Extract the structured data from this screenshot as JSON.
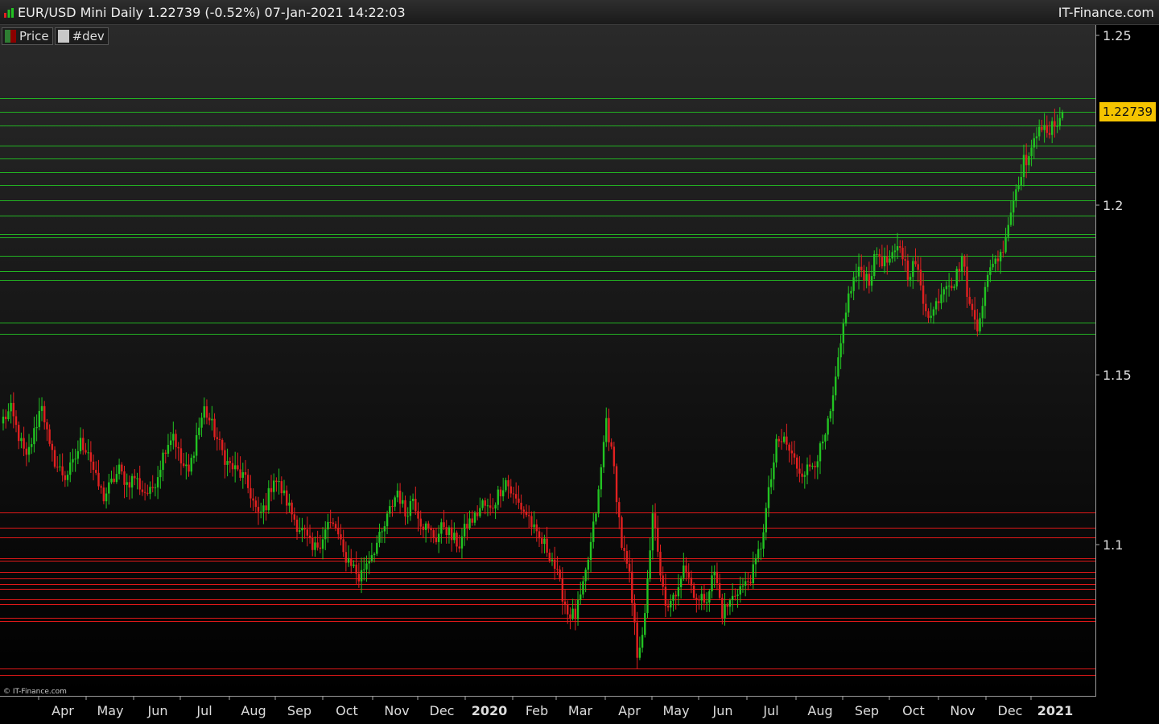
{
  "header": {
    "title": "EUR/USD Mini Daily 1.22739 (-0.52%) 07-Jan-2021 14:22:03",
    "brand": "IT-Finance.com"
  },
  "legend": {
    "items": [
      {
        "label": "Price",
        "color": "#2e7d32"
      },
      {
        "label": "#dev",
        "color": "#c8c8c8"
      }
    ]
  },
  "copyright": "© IT-Finance.com",
  "current_price": "1.22739",
  "colors": {
    "up": "#22c322",
    "down": "#e02020",
    "resistance": "#22b222",
    "support": "#e01818",
    "badge": "#f5c400"
  },
  "chart_data": {
    "type": "candlestick",
    "title": "EUR/USD Mini Daily",
    "ylim": [
      1.0545,
      1.2545
    ],
    "y_ticks": [
      {
        "value": 1.25,
        "label": "1.25"
      },
      {
        "value": 1.2,
        "label": "1.2"
      },
      {
        "value": 1.15,
        "label": "1.15"
      },
      {
        "value": 1.1,
        "label": "1.1"
      }
    ],
    "x_ticks": [
      {
        "label": "Apr",
        "bold": false
      },
      {
        "label": "May",
        "bold": false
      },
      {
        "label": "Jun",
        "bold": false
      },
      {
        "label": "Jul",
        "bold": false
      },
      {
        "label": "Aug",
        "bold": false
      },
      {
        "label": "Sep",
        "bold": false
      },
      {
        "label": "Oct",
        "bold": false
      },
      {
        "label": "Nov",
        "bold": false
      },
      {
        "label": "Dec",
        "bold": false
      },
      {
        "label": "2020",
        "bold": true
      },
      {
        "label": "Feb",
        "bold": false
      },
      {
        "label": "Mar",
        "bold": false
      },
      {
        "label": "Apr",
        "bold": false
      },
      {
        "label": "May",
        "bold": false
      },
      {
        "label": "Jun",
        "bold": false
      },
      {
        "label": "Jul",
        "bold": false
      },
      {
        "label": "Aug",
        "bold": false
      },
      {
        "label": "Sep",
        "bold": false
      },
      {
        "label": "Oct",
        "bold": false
      },
      {
        "label": "Nov",
        "bold": false
      },
      {
        "label": "Dec",
        "bold": false
      },
      {
        "label": "2021",
        "bold": true
      }
    ],
    "resistance_levels": [
      1.2315,
      1.2275,
      1.2235,
      1.2175,
      1.2138,
      1.2098,
      1.206,
      1.2015,
      1.197,
      1.1915,
      1.1905,
      1.185,
      1.1805,
      1.178,
      1.1655,
      1.162
    ],
    "support_levels": [
      1.1095,
      1.105,
      1.1022,
      1.096,
      1.0952,
      1.092,
      1.09,
      1.0885,
      1.087,
      1.084,
      1.0825,
      1.0785,
      1.0775,
      1.0635,
      1.0615
    ],
    "close_series": [
      [
        0,
        1.137
      ],
      [
        3,
        1.1395
      ],
      [
        6,
        1.132
      ],
      [
        9,
        1.125
      ],
      [
        12,
        1.133
      ],
      [
        15,
        1.142
      ],
      [
        18,
        1.128
      ],
      [
        21,
        1.123
      ],
      [
        24,
        1.12
      ],
      [
        27,
        1.1235
      ],
      [
        30,
        1.13
      ],
      [
        33,
        1.128
      ],
      [
        36,
        1.119
      ],
      [
        39,
        1.114
      ],
      [
        42,
        1.118
      ],
      [
        45,
        1.122
      ],
      [
        48,
        1.118
      ],
      [
        51,
        1.12
      ],
      [
        54,
        1.116
      ],
      [
        57,
        1.115
      ],
      [
        60,
        1.121
      ],
      [
        63,
        1.129
      ],
      [
        66,
        1.133
      ],
      [
        69,
        1.124
      ],
      [
        72,
        1.121
      ],
      [
        75,
        1.132
      ],
      [
        78,
        1.14
      ],
      [
        81,
        1.135
      ],
      [
        84,
        1.129
      ],
      [
        87,
        1.124
      ],
      [
        90,
        1.122
      ],
      [
        93,
        1.12
      ],
      [
        96,
        1.115
      ],
      [
        99,
        1.108
      ],
      [
        102,
        1.112
      ],
      [
        105,
        1.12
      ],
      [
        108,
        1.116
      ],
      [
        111,
        1.111
      ],
      [
        114,
        1.106
      ],
      [
        117,
        1.103
      ],
      [
        120,
        1.098
      ],
      [
        123,
        1.101
      ],
      [
        126,
        1.106
      ],
      [
        129,
        1.105
      ],
      [
        132,
        1.097
      ],
      [
        135,
        1.095
      ],
      [
        138,
        1.09
      ],
      [
        141,
        1.095
      ],
      [
        144,
        1.099
      ],
      [
        147,
        1.103
      ],
      [
        150,
        1.11
      ],
      [
        153,
        1.116
      ],
      [
        156,
        1.109
      ],
      [
        159,
        1.114
      ],
      [
        162,
        1.107
      ],
      [
        165,
        1.104
      ],
      [
        168,
        1.102
      ],
      [
        171,
        1.106
      ],
      [
        174,
        1.102
      ],
      [
        177,
        1.1
      ],
      [
        180,
        1.106
      ],
      [
        183,
        1.108
      ],
      [
        186,
        1.112
      ],
      [
        189,
        1.11
      ],
      [
        192,
        1.115
      ],
      [
        195,
        1.119
      ],
      [
        198,
        1.114
      ],
      [
        201,
        1.111
      ],
      [
        204,
        1.108
      ],
      [
        207,
        1.102
      ],
      [
        210,
        1.1
      ],
      [
        213,
        1.096
      ],
      [
        216,
        1.088
      ],
      [
        219,
        1.08
      ],
      [
        222,
        1.079
      ],
      [
        225,
        1.087
      ],
      [
        228,
        1.1
      ],
      [
        231,
        1.115
      ],
      [
        234,
        1.137
      ],
      [
        237,
        1.122
      ],
      [
        240,
        1.1
      ],
      [
        243,
        1.09
      ],
      [
        246,
        1.068
      ],
      [
        249,
        1.078
      ],
      [
        252,
        1.11
      ],
      [
        255,
        1.09
      ],
      [
        258,
        1.08
      ],
      [
        261,
        1.086
      ],
      [
        264,
        1.095
      ],
      [
        267,
        1.088
      ],
      [
        270,
        1.083
      ],
      [
        273,
        1.085
      ],
      [
        276,
        1.092
      ],
      [
        279,
        1.08
      ],
      [
        282,
        1.083
      ],
      [
        285,
        1.087
      ],
      [
        288,
        1.088
      ],
      [
        291,
        1.092
      ],
      [
        294,
        1.1
      ],
      [
        297,
        1.115
      ],
      [
        300,
        1.129
      ],
      [
        303,
        1.131
      ],
      [
        306,
        1.126
      ],
      [
        309,
        1.122
      ],
      [
        312,
        1.122
      ],
      [
        315,
        1.125
      ],
      [
        318,
        1.129
      ],
      [
        321,
        1.138
      ],
      [
        324,
        1.153
      ],
      [
        327,
        1.17
      ],
      [
        330,
        1.178
      ],
      [
        333,
        1.181
      ],
      [
        336,
        1.178
      ],
      [
        339,
        1.186
      ],
      [
        342,
        1.183
      ],
      [
        345,
        1.184
      ],
      [
        348,
        1.188
      ],
      [
        351,
        1.18
      ],
      [
        354,
        1.183
      ],
      [
        357,
        1.172
      ],
      [
        360,
        1.167
      ],
      [
        363,
        1.173
      ],
      [
        366,
        1.178
      ],
      [
        369,
        1.177
      ],
      [
        372,
        1.185
      ],
      [
        375,
        1.17
      ],
      [
        378,
        1.165
      ],
      [
        381,
        1.175
      ],
      [
        384,
        1.184
      ],
      [
        387,
        1.185
      ],
      [
        390,
        1.195
      ],
      [
        393,
        1.205
      ],
      [
        396,
        1.213
      ],
      [
        399,
        1.215
      ],
      [
        402,
        1.225
      ],
      [
        405,
        1.22
      ],
      [
        408,
        1.224
      ],
      [
        411,
        1.2274
      ]
    ]
  }
}
